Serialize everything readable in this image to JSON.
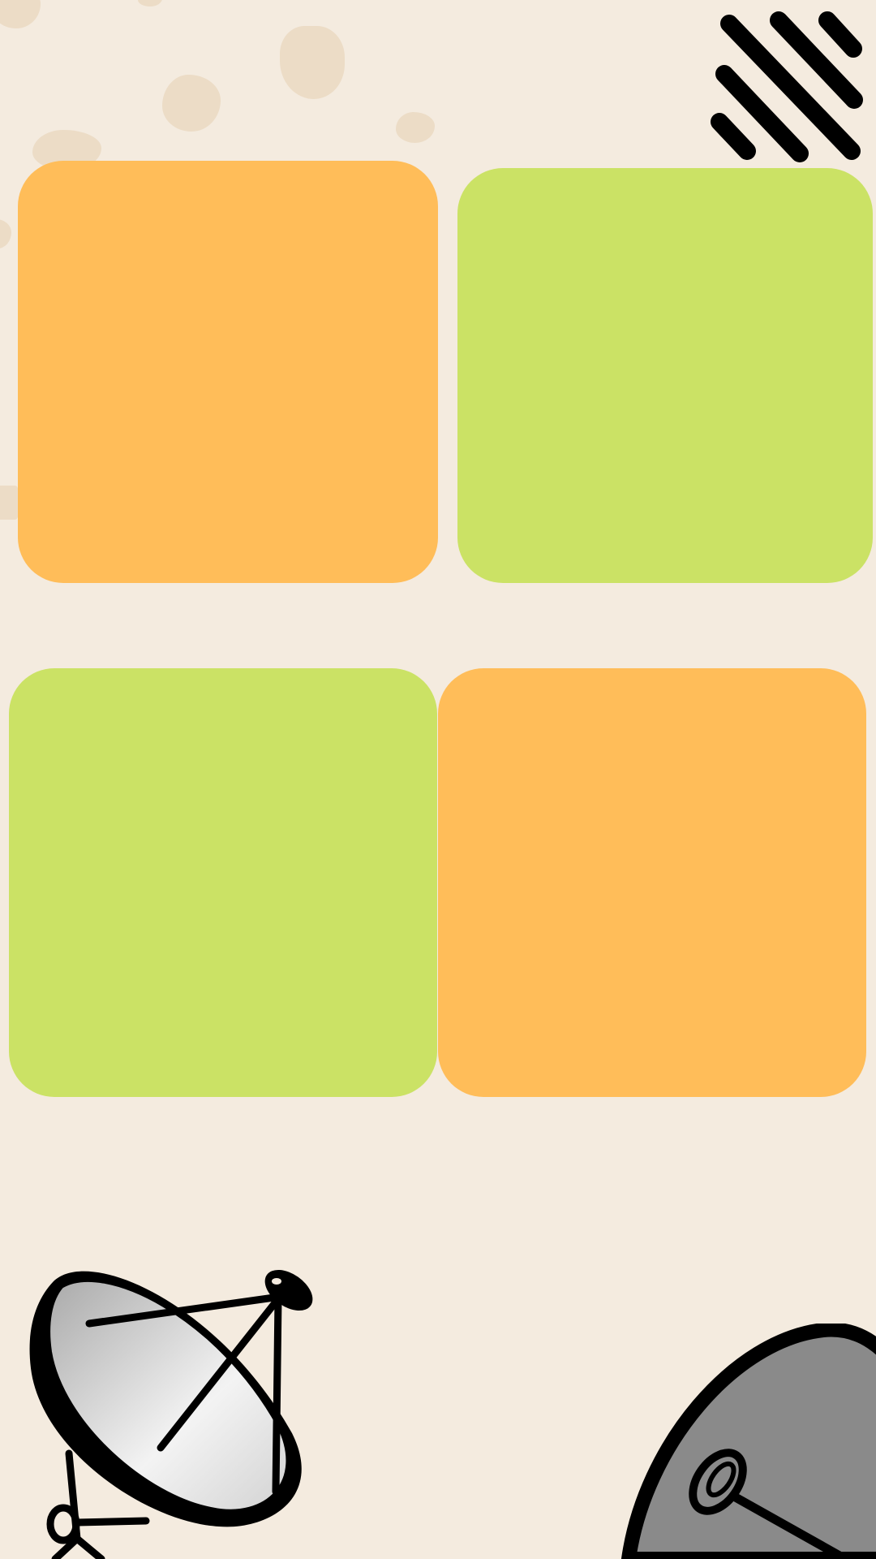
{
  "colors": {
    "background": "#f4ebdf",
    "blob": "#ecdcc6",
    "orange_tile": "#ffbd59",
    "green_tile": "#cbe265",
    "ink": "#000000",
    "dish_gray": "#8a8a8a"
  },
  "tiles": [
    {
      "id": "top-left",
      "color": "orange"
    },
    {
      "id": "top-right",
      "color": "green"
    },
    {
      "id": "bottom-left",
      "color": "green"
    },
    {
      "id": "bottom-right",
      "color": "orange"
    }
  ],
  "icons": {
    "top_right": "diagonal-lines-icon",
    "bottom_left": "satellite-dish-icon",
    "bottom_right": "satellite-dish-icon"
  }
}
